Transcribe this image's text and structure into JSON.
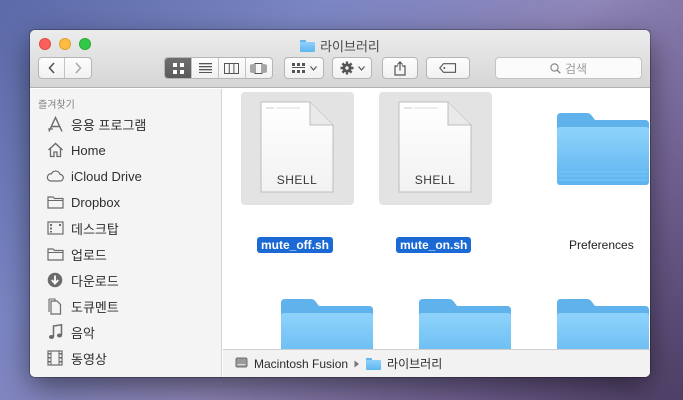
{
  "window": {
    "title": "라이브러리"
  },
  "toolbar": {
    "back_icon": "chevron-left-icon",
    "forward_icon": "chevron-right-icon",
    "view_modes": [
      "icon-view",
      "list-view",
      "column-view",
      "cover-flow-view"
    ],
    "arrange_icon": "arrange-grid-icon",
    "action_icon": "gear-icon",
    "share_icon": "share-icon",
    "tag_icon": "tag-icon",
    "search_placeholder": "검색"
  },
  "sidebar": {
    "header": "즐겨찾기",
    "items": [
      {
        "label": "응용 프로그램",
        "icon": "applications-icon"
      },
      {
        "label": "Home",
        "icon": "home-icon"
      },
      {
        "label": "iCloud Drive",
        "icon": "cloud-icon"
      },
      {
        "label": "Dropbox",
        "icon": "folder-icon"
      },
      {
        "label": "데스크탑",
        "icon": "desktop-icon"
      },
      {
        "label": "업로드",
        "icon": "folder-icon"
      },
      {
        "label": "다운로드",
        "icon": "download-icon"
      },
      {
        "label": "도큐멘트",
        "icon": "document-icon"
      },
      {
        "label": "음악",
        "icon": "music-icon"
      },
      {
        "label": "동영상",
        "icon": "movie-icon"
      }
    ]
  },
  "files": [
    {
      "name": "mute_off.sh",
      "kind": "SHELL",
      "selected": true
    },
    {
      "name": "mute_on.sh",
      "kind": "SHELL",
      "selected": true
    },
    {
      "name": "Preferences",
      "kind": "folder",
      "selected": false
    }
  ],
  "pathbar": {
    "items": [
      "Macintosh Fusion",
      "라이브러리"
    ]
  },
  "colors": {
    "selection": "#1a69d5",
    "folder": "#6cc1f6",
    "close": "#fc605c",
    "minimize": "#fdbc40",
    "maximize": "#34c84a"
  }
}
